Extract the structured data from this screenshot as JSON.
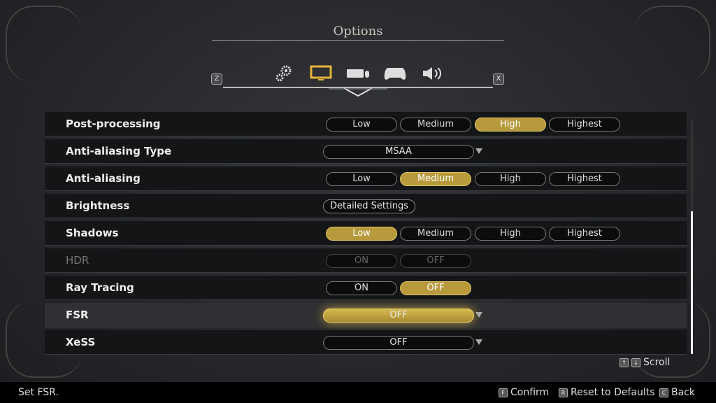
{
  "title": "Options",
  "tabs": {
    "prev_key": "Z",
    "next_key": "X",
    "items": [
      {
        "icon": "gears-icon"
      },
      {
        "icon": "monitor-icon",
        "active": true
      },
      {
        "icon": "keyboard-mouse-icon"
      },
      {
        "icon": "gamepad-icon"
      },
      {
        "icon": "speaker-icon"
      }
    ]
  },
  "colors": {
    "accent": "#b89a3c"
  },
  "rows": [
    {
      "label": "Post-processing",
      "type": "options",
      "options": [
        "Low",
        "Medium",
        "High",
        "Highest"
      ],
      "selected": 2
    },
    {
      "label": "Anti-aliasing Type",
      "type": "dropdown",
      "value": "MSAA"
    },
    {
      "label": "Anti-aliasing",
      "type": "options",
      "options": [
        "Low",
        "Medium",
        "High",
        "Highest"
      ],
      "selected": 1
    },
    {
      "label": "Brightness",
      "type": "button",
      "value": "Detailed Settings"
    },
    {
      "label": "Shadows",
      "type": "options",
      "options": [
        "Low",
        "Medium",
        "High",
        "Highest"
      ],
      "selected": 0
    },
    {
      "label": "HDR",
      "type": "options",
      "options": [
        "ON",
        "OFF"
      ],
      "selected": -1,
      "disabled": true
    },
    {
      "label": "Ray Tracing",
      "type": "options",
      "options": [
        "ON",
        "OFF"
      ],
      "selected": 1
    },
    {
      "label": "FSR",
      "type": "dropdown",
      "value": "OFF",
      "focused": true
    },
    {
      "label": "XeSS",
      "type": "dropdown",
      "value": "OFF"
    }
  ],
  "scroll": {
    "up_key": "↑",
    "down_key": "↓",
    "label": "Scroll",
    "position_percent": 60
  },
  "footer": {
    "help": "Set FSR.",
    "confirm_key": "F",
    "confirm": "Confirm",
    "reset_key": "R",
    "reset": "Reset to Defaults",
    "back_key": "C",
    "back": "Back"
  }
}
